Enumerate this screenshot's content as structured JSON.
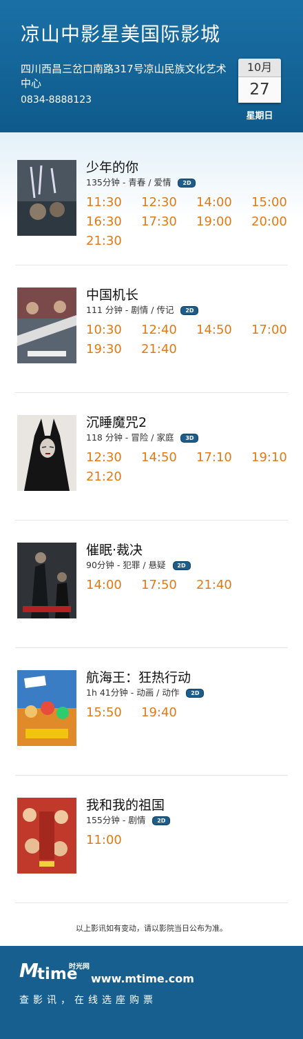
{
  "header": {
    "cinema_name": "凉山中影星美国际影城",
    "address": "四川西昌三岔口南路317号凉山民族文化艺术中心",
    "phone": "0834-8888123",
    "month": "10月",
    "day": "27",
    "weekday": "星期日"
  },
  "colors": {
    "header_bg": "#1a70a5",
    "showtime": "#e07a14",
    "footer_bg": "#175f8e"
  },
  "movies": [
    {
      "title": "少年的你",
      "meta": "135分钟 - 青春 / 爱情",
      "format": "2D",
      "times": [
        "11:30",
        "12:30",
        "14:00",
        "15:00",
        "16:30",
        "17:30",
        "19:00",
        "20:00",
        "21:30"
      ]
    },
    {
      "title": "中国机长",
      "meta": "111 分钟 - 剧情 / 传记",
      "format": "2D",
      "times": [
        "10:30",
        "12:40",
        "14:50",
        "17:00",
        "19:30",
        "21:40"
      ]
    },
    {
      "title": "沉睡魔咒2",
      "meta": "118 分钟 - 冒险 / 家庭",
      "format": "3D",
      "times": [
        "12:30",
        "14:50",
        "17:10",
        "19:10",
        "21:20"
      ]
    },
    {
      "title": "催眠·裁决",
      "meta": "90分钟 - 犯罪 / 悬疑",
      "format": "2D",
      "times": [
        "14:00",
        "17:50",
        "21:40"
      ]
    },
    {
      "title": "航海王：狂热行动",
      "meta": "1h 41分钟 - 动画 / 动作",
      "format": "2D",
      "times": [
        "15:50",
        "19:40"
      ]
    },
    {
      "title": "我和我的祖国",
      "meta": "155分钟 - 剧情",
      "format": "2D",
      "times": [
        "11:00"
      ]
    }
  ],
  "notice": "以上影讯如有变动，请以影院当日公布为准。",
  "footer": {
    "logo_m": "M",
    "logo_text": "time",
    "logo_cn": "时光网",
    "site": "www.mtime.com",
    "slogan": "查影讯，在线选座购票"
  }
}
